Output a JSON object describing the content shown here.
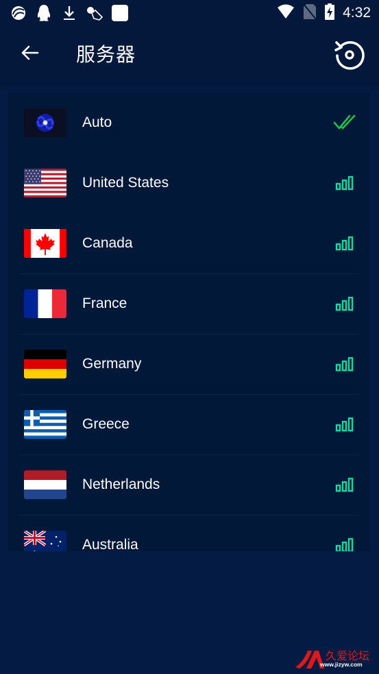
{
  "status_bar": {
    "left_icons": [
      "app-swirl-icon",
      "qq-penguin-icon",
      "download-icon",
      "gesture-icon",
      "blank-app-icon"
    ],
    "right_icons": [
      "wifi-icon",
      "no-sim-icon",
      "battery-charging-icon"
    ],
    "time": "4:32"
  },
  "app_bar": {
    "back_icon": "arrow-left-icon",
    "title": "服务器",
    "refresh_icon": "refresh-target-icon"
  },
  "colors": {
    "background": "#041c43",
    "card": "#021839",
    "selected_check": "#1ec24a",
    "signal": "#1fd6a3"
  },
  "servers": [
    {
      "name": "Auto",
      "flag": "galaxy",
      "status": "selected",
      "status_icon": "double-check-icon"
    },
    {
      "name": "United States",
      "flag": "us",
      "status": "signal",
      "status_icon": "signal-bars-icon",
      "signal_level": "3/3"
    },
    {
      "name": "Canada",
      "flag": "ca",
      "status": "signal",
      "status_icon": "signal-bars-icon",
      "signal_level": "3/3"
    },
    {
      "name": "France",
      "flag": "fr",
      "status": "signal",
      "status_icon": "signal-bars-icon",
      "signal_level": "3/3"
    },
    {
      "name": "Germany",
      "flag": "de",
      "status": "signal",
      "status_icon": "signal-bars-icon",
      "signal_level": "3/3"
    },
    {
      "name": "Greece",
      "flag": "gr",
      "status": "signal",
      "status_icon": "signal-bars-icon",
      "signal_level": "3/3"
    },
    {
      "name": "Netherlands",
      "flag": "nl",
      "status": "signal",
      "status_icon": "signal-bars-icon",
      "signal_level": "3/3"
    },
    {
      "name": "Australia",
      "flag": "au",
      "status": "signal",
      "status_icon": "signal-bars-icon",
      "signal_level": "3/3"
    }
  ],
  "watermark": {
    "brand": "久爱论坛",
    "url": "www.jizyw.com"
  }
}
